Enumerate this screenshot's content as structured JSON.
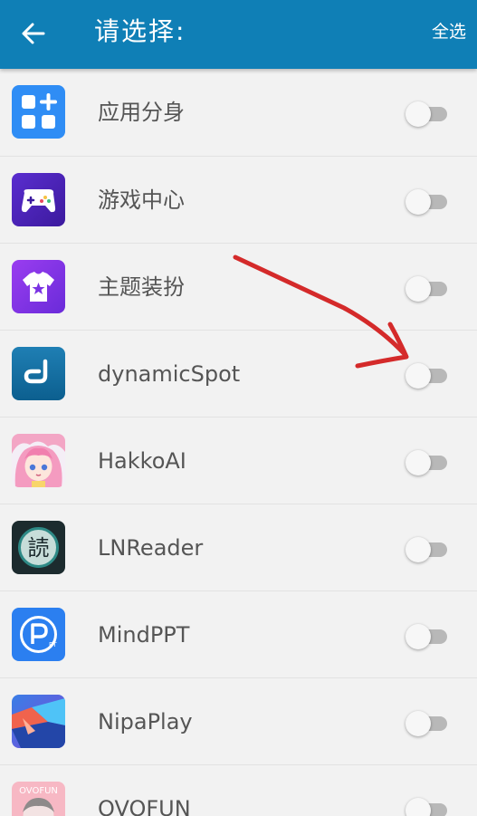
{
  "header": {
    "title": "请选择:",
    "select_all_label": "全选",
    "back_icon": "arrow-left-icon",
    "background_color": "#0f7fb6"
  },
  "apps": [
    {
      "label": "应用分身",
      "icon": "app-clone-icon",
      "enabled": false
    },
    {
      "label": "游戏中心",
      "icon": "game-center-icon",
      "enabled": false
    },
    {
      "label": "主题装扮",
      "icon": "theme-icon",
      "enabled": false
    },
    {
      "label": "dynamicSpot",
      "icon": "dynamicspot-icon",
      "enabled": false
    },
    {
      "label": "HakkoAI",
      "icon": "hakkoai-icon",
      "enabled": false
    },
    {
      "label": "LNReader",
      "icon": "lnreader-icon",
      "enabled": false
    },
    {
      "label": "MindPPT",
      "icon": "mindppt-icon",
      "enabled": false
    },
    {
      "label": "NipaPlay",
      "icon": "nipaplay-icon",
      "enabled": false
    },
    {
      "label": "OVOFUN",
      "icon": "ovofun-icon",
      "enabled": false
    }
  ],
  "annotation": {
    "type": "red-hand-drawn-arrow",
    "color": "#d42a2a",
    "points_to": "dynamicSpot toggle"
  }
}
